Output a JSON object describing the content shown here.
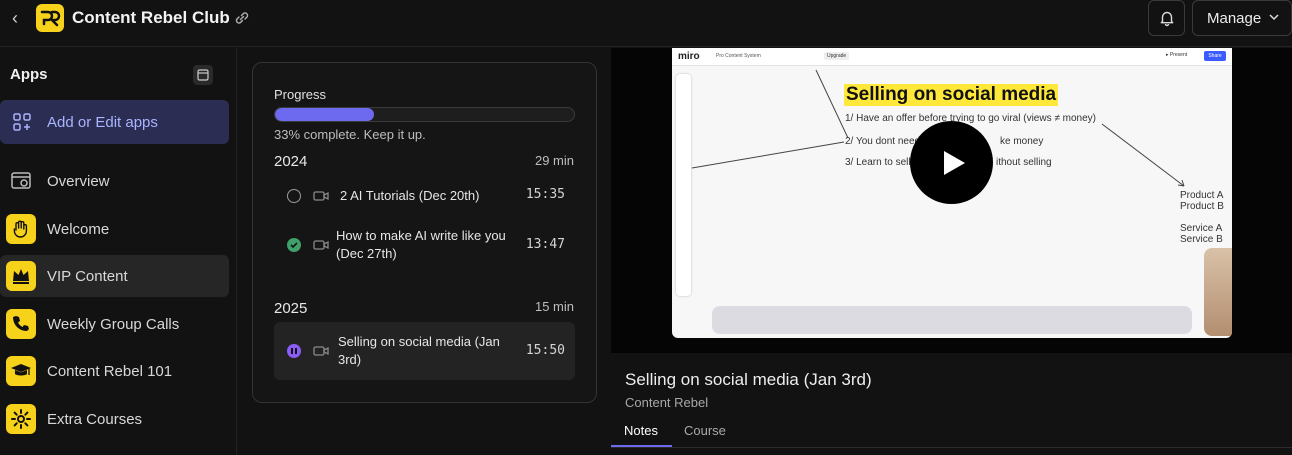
{
  "header": {
    "club_title": "Content Rebel Club",
    "manage_label": "Manage",
    "icons": [
      "chevron-left-icon",
      "club-logo",
      "link-icon",
      "bell-icon",
      "chevron-down-icon"
    ]
  },
  "sidebar": {
    "title": "Apps",
    "add_label": "Add or Edit apps",
    "items": [
      {
        "label": "Overview",
        "icon": "overview-icon"
      },
      {
        "label": "Welcome",
        "icon": "wave-hand-icon"
      },
      {
        "label": "VIP Content",
        "icon": "crown-icon",
        "active": true
      },
      {
        "label": "Weekly Group Calls",
        "icon": "phone-icon"
      },
      {
        "label": "Content Rebel 101",
        "icon": "graduation-cap-icon"
      },
      {
        "label": "Extra Courses",
        "icon": "gear-icon"
      }
    ]
  },
  "course": {
    "progress_title": "Progress",
    "progress_fraction": 0.33,
    "progress_text": "33% complete. Keep it up.",
    "sections": [
      {
        "year": "2024",
        "duration": "29 min",
        "lessons": [
          {
            "title": "2 AI Tutorials (Dec 20th)",
            "duration": "15:35",
            "status": "not-started"
          },
          {
            "title": "How to make AI write like you",
            "title2": "(Dec 27th)",
            "duration": "13:47",
            "status": "completed"
          }
        ]
      },
      {
        "year": "2025",
        "duration": "15 min",
        "lessons": [
          {
            "title": "Selling on social media (Jan",
            "title2": "3rd)",
            "duration": "15:50",
            "status": "in-progress"
          }
        ]
      }
    ]
  },
  "video": {
    "miro_logo": "miro",
    "board_name": "Pro Content System",
    "upgrade_label": "Upgrade",
    "present_label": "▸ Present",
    "share_label": "Share",
    "board_title": "Selling on social media",
    "board_lines": [
      "1/ Have an offer before trying to go viral (views ≠ money)",
      "2/ You dont need",
      "ke money",
      "3/ Learn to sell",
      "ithout selling"
    ],
    "board_products": [
      "Product A",
      "Product B",
      "Service A",
      "Service B"
    ]
  },
  "lesson": {
    "title": "Selling on social media (Jan 3rd)",
    "subtitle": "Content Rebel",
    "tabs": [
      "Notes",
      "Course"
    ]
  },
  "colors": {
    "accent": "#6d6af0",
    "brand_yellow": "#f7d21a",
    "complete_green": "#3fa06a",
    "progress_purple": "#8b5cf6"
  }
}
